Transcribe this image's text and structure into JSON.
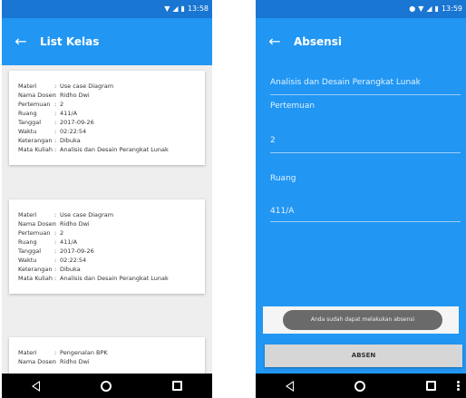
{
  "left_screen": {
    "status_time": "13:58",
    "title": "List Kelas",
    "labels": {
      "materi": "Materi",
      "dosen": "Nama Dosen",
      "pertemuan": "Pertemuan",
      "ruang": "Ruang",
      "tanggal": "Tanggal",
      "waktu": "Waktu",
      "keterangan": "Keterangan",
      "matkul": "Mata Kuliah",
      "sep": ":"
    },
    "cards": [
      {
        "materi": "Use case Diagram",
        "dosen": "Ridho Dwi",
        "pertemuan": "2",
        "ruang": "411/A",
        "tanggal": "2017-09-26",
        "waktu": "02:22:54",
        "keterangan": "Dibuka",
        "matkul": "Analisis dan Desain Perangkat Lunak"
      },
      {
        "materi": "Use case Diagram",
        "dosen": "Ridho Dwi",
        "pertemuan": "2",
        "ruang": "411/A",
        "tanggal": "2017-09-26",
        "waktu": "02:22:54",
        "keterangan": "Dibuka",
        "matkul": "Analisis dan Desain Perangkat Lunak"
      },
      {
        "materi": "Pengenalan BPK",
        "dosen": "Ridho Dwi"
      }
    ]
  },
  "right_screen": {
    "status_time": "13:59",
    "title": "Absensi",
    "matkul_value": "Analisis dan Desain Perangkat Lunak",
    "pertemuan_label": "Pertemuan",
    "pertemuan_value": "2",
    "ruang_label": "Ruang",
    "ruang_value": "411/A",
    "toast": "Anda sudah dapat melakukan absensi",
    "absen_button": "ABSEN"
  },
  "colors": {
    "primary": "#2196f3",
    "primary_dark": "#1976d2"
  }
}
